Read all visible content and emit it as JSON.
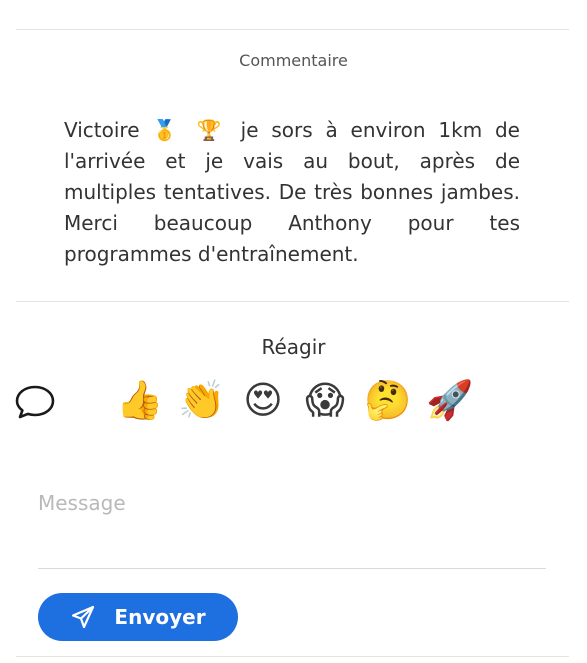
{
  "comment": {
    "heading": "Commentaire",
    "text": "Victoire 🥇 🏆  je sors à environ 1km de l'arrivée et je vais au bout, après de multiples tentatives. De très bonnes jambes. Merci beaucoup Anthony pour tes programmes d'entraînement."
  },
  "reactions": {
    "heading": "Réagir",
    "chat_icon": "speech-bubble-icon",
    "items": [
      {
        "emoji": "👍",
        "icon": "thumbs-up-icon"
      },
      {
        "emoji": "👏",
        "icon": "clapping-hands-icon"
      },
      {
        "emoji": "😍",
        "icon": "heart-eyes-icon"
      },
      {
        "emoji": "😱",
        "icon": "screaming-face-icon"
      },
      {
        "emoji": "🤔",
        "icon": "thinking-face-icon"
      },
      {
        "emoji": "🚀",
        "icon": "rocket-icon"
      }
    ]
  },
  "message": {
    "value": "",
    "placeholder": "Message"
  },
  "send": {
    "label": "Envoyer",
    "icon": "paper-plane-icon",
    "color": "#1e6fe0"
  }
}
